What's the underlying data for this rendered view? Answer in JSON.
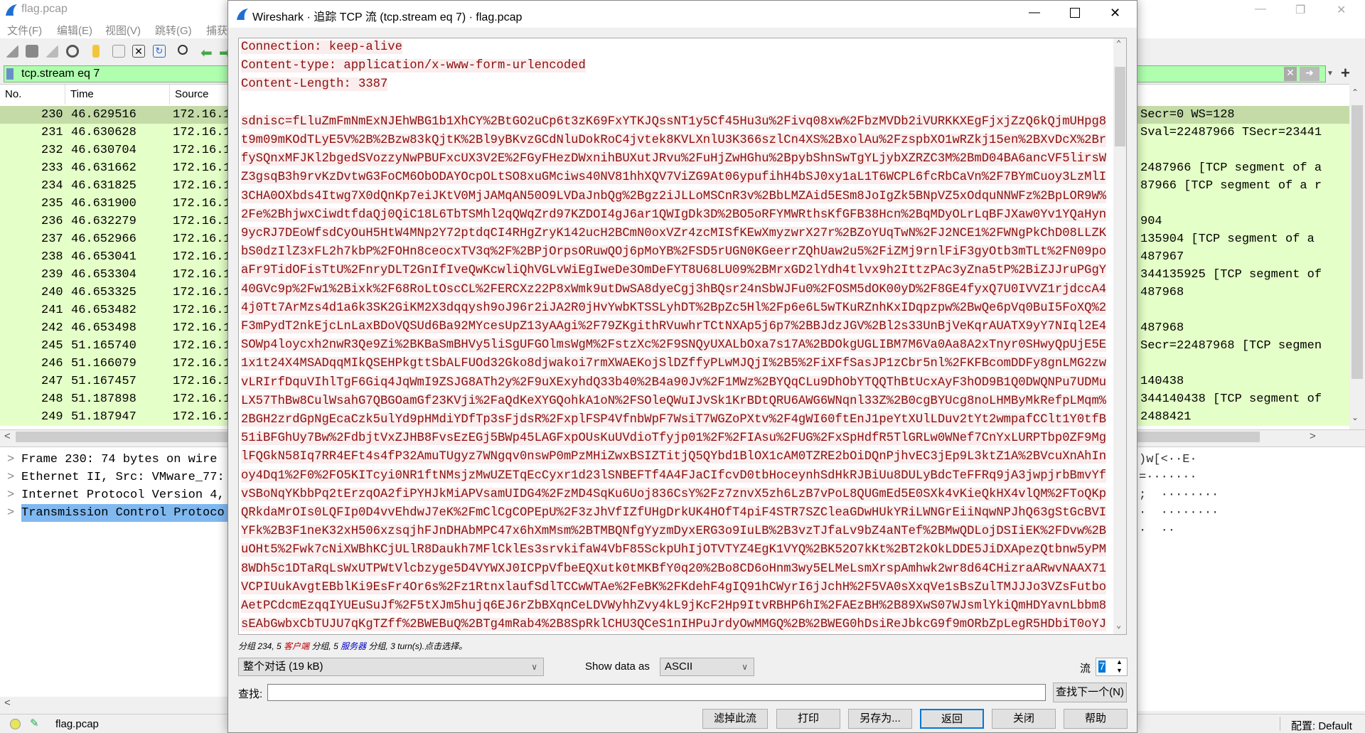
{
  "main_window": {
    "title": "flag.pcap",
    "menu": [
      "文件(F)",
      "编辑(E)",
      "视图(V)",
      "跳转(G)",
      "捕获"
    ],
    "filter_value": "tcp.stream eq 7",
    "columns": [
      "No.",
      "Time",
      "Source"
    ],
    "packets": [
      {
        "no": "230",
        "time": "46.629516",
        "src": "172.16.1",
        "info": "Secr=0 WS=128"
      },
      {
        "no": "231",
        "time": "46.630628",
        "src": "172.16.1",
        "info": "Sval=22487966 TSecr=23441"
      },
      {
        "no": "232",
        "time": "46.630704",
        "src": "172.16.1",
        "info": ""
      },
      {
        "no": "233",
        "time": "46.631662",
        "src": "172.16.1",
        "info": "2487966 [TCP segment of a"
      },
      {
        "no": "234",
        "time": "46.631825",
        "src": "172.16.1",
        "info": "87966 [TCP segment of a r"
      },
      {
        "no": "235",
        "time": "46.631900",
        "src": "172.16.1",
        "info": ""
      },
      {
        "no": "236",
        "time": "46.632279",
        "src": "172.16.1",
        "info": "904"
      },
      {
        "no": "237",
        "time": "46.652966",
        "src": "172.16.1",
        "info": "135904 [TCP segment of a"
      },
      {
        "no": "238",
        "time": "46.653041",
        "src": "172.16.1",
        "info": "487967"
      },
      {
        "no": "239",
        "time": "46.653304",
        "src": "172.16.1",
        "info": "344135925 [TCP segment of"
      },
      {
        "no": "240",
        "time": "46.653325",
        "src": "172.16.1",
        "info": "487968"
      },
      {
        "no": "241",
        "time": "46.653482",
        "src": "172.16.1",
        "info": ""
      },
      {
        "no": "242",
        "time": "46.653498",
        "src": "172.16.1",
        "info": "487968"
      },
      {
        "no": "245",
        "time": "51.165740",
        "src": "172.16.1",
        "info": "Secr=22487968 [TCP segmen"
      },
      {
        "no": "246",
        "time": "51.166079",
        "src": "172.16.1",
        "info": ""
      },
      {
        "no": "247",
        "time": "51.167457",
        "src": "172.16.1",
        "info": "140438"
      },
      {
        "no": "248",
        "time": "51.187898",
        "src": "172.16.1",
        "info": "344140438 [TCP segment of"
      },
      {
        "no": "249",
        "time": "51.187947",
        "src": "172.16.1",
        "info": "2488421"
      }
    ],
    "selected_packet": "230",
    "details": [
      "Frame 230: 74 bytes on wire",
      "Ethernet II, Src: VMware_77:",
      "Internet Protocol Version 4,",
      "Transmission Control Protoco"
    ],
    "bytes_ascii": [
      ")w[<··E·",
      "=·······",
      ";  ········",
      "·  ········",
      "·  ··"
    ],
    "status_file": "flag.pcap",
    "status_profile": "配置: Default"
  },
  "dialog": {
    "title": "Wireshark · 追踪 TCP 流 (tcp.stream eq 7) · flag.pcap",
    "headers": [
      "Connection: keep-alive",
      "Content-type: application/x-www-form-urlencoded",
      "Content-Length: 3387"
    ],
    "body_lines": [
      "sdnisc=fLluZmFmNmExNJEhWBG1b1XhCY%2BtGO2uCp6t3zK69FxYTKJQssNT1y5Cf45Hu3u%2Fivq08xw%2FbzMVDb2iVURKKXEgFjxjZzQ6kQjmUHpg8",
      "t9m09mKOdTLyE5V%2B%2Bzw83kQjtK%2Bl9yBKvzGCdNluDokRoC4jvtek8KVLXnlU3K366szlCn4XS%2BxolAu%2FzspbXO1wRZkj15en%2BXvDcX%2Br",
      "fySQnxMFJKl2bgedSVozzyNwPBUFxcUX3V2E%2FGyFHezDWxnihBUXutJRvu%2FuHjZwHGhu%2BpybShnSwTgYLjybXZRZC3M%2BmD04BA6ancVF5lirsW",
      "Z3gsqB3h9rvKzDvtwG3FoCM6ObODAYOcpOLtSO8xuGMciws40NV81hhXQV7ViZG9At06ypufihH4bSJ0xy1aL1T6WCPL6fcRbCaVn%2F7BYmCuoy3LzMlI",
      "3CHA0OXbds4Itwg7X0dQnKp7eiJKtV0MjJAMqAN50O9LVDaJnbQg%2Bgz2iJLLoMSCnR3v%2BbLMZAid5ESm8JoIgZk5BNpVZ5xOdquNNWFz%2BpLOR9W%",
      "2Fe%2BhjwxCiwdtfdaQj0QiC18L6TbTSMhl2qQWqZrd97KZDOI4gJ6ar1QWIgDk3D%2BO5oRFYMWRthsKfGFB38Hcn%2BqMDyOLrLqBFJXaw0Yv1YQaHyn",
      "9ycRJ7DEoWfsdCyOuH5HtW4MNp2Y72ptdqCI4RHgZryK142ucH2BCmN0oxVZr4zcMISfKEwXmyzwrX27r%2BZoYUqTwN%2FJ2NCE1%2FWNgPkChD08LLZK",
      "bS0dzIlZ3xFL2h7kbP%2FOHn8ceocxTV3q%2F%2BPjOrpsORuwQOj6pMoYB%2FSD5rUGN0KGeerrZQhUaw2u5%2FiZMj9rnlFiF3gyOtb3mTLt%2FN09po",
      "aFr9TidOFisTtU%2FnryDLT2GnIfIveQwKcwliQhVGLvWiEgIweDe3OmDeFYT8U68LU09%2BMrxGD2lYdh4tlvx9h2IttzPAc3yZna5tP%2BiZJJruPGgY",
      "40GVc9p%2Fw1%2Bixk%2F68RoLtOscCL%2FERCXz22P8xWmk9utDwSA8dyeCgj3hBQsr24nSbWJFu0%2FOSM5dOK00yD%2F8GE4fyxQ7U0IVVZ1rjdccA4",
      "4j0Tt7ArMzs4d1a6k3SK2GiKM2X3dqqysh9oJ96r2iJA2R0jHvYwbKTSSLyhDT%2BpZc5Hl%2Fp6e6L5wTKuRZnhKxIDqpzpw%2BwQe6pVq0BuI5FoXQ%2",
      "F3mPydT2nkEjcLnLaxBDoVQSUd6Ba92MYcesUpZ13yAAgi%2F79ZKgithRVuwhrTCtNXAp5j6p7%2BBJdzJGV%2Bl2s33UnBjVeKqrAUATX9yY7NIql2E4",
      "SOWp4loycxh2nwR3Qe9Zi%2BKBaSmBHVy5liSgUFGOlmsWgM%2FstzXc%2F9SNQyUXALbOxa7s17A%2BDOkgUGLIBM7M6Va0Aa8A2xTnyr0SHwyQpUjE5E",
      "1x1t24X4MSADqqMIkQSEHPkgttSbALFUOd32Gko8djwakoi7rmXWAEKojSlDZffyPLwMJQjI%2B5%2FiXFfSasJP1zCbr5nl%2FKFBcomDDFy8gnLMG2zw",
      "vLRIrfDquVIhlTgF6Giq4JqWmI9ZSJG8ATh2y%2F9uXExyhdQ33b40%2B4a90Jv%2F1MWz%2BYQqCLu9DhObYTQQThBtUcxAyF3hOD9B1Q0DWQNPu7UDMu",
      "LX57ThBw8CulWsahG7QBGOamGf23KVji%2FaQdKeXYGQohkA1oN%2FSOleQWuIJvSk1KrBDtQRU6AWG6WNqnl33Z%2B0cgBYUcg8noLHMByMkRefpLMqm%",
      "2BGH2zrdGpNgEcaCzk5ulYd9pHMdiYDfTp3sFjdsR%2FxplFSP4VfnbWpF7WsiT7WGZoPXtv%2F4gWI60ftEnJ1peYtXUlLDuv2tYt2wmpafCClt1Y0tfB",
      "51iBFGhUy7Bw%2FdbjtVxZJHB8FvsEzEGj5BWp45LAGFxpOUsKuUVdioTfyjp01%2F%2FIAsu%2FUG%2FxSpHdfR5TlGRLw0WNef7CnYxLURPTbp0ZF9Mg",
      "lFQGkN58Iq7RR4EFt4s4fP32AmuTUgyz7WNgqv0nswP0mPzMHiZwxBSIZTitjQ5QYbd1BlOX1cAM0TZRE2bOiDQnPjhvEC3jEp9L3ktZ1A%2BVcuXnAhIn",
      "oy4Dq1%2F0%2FO5KITcyi0NR1ftNMsjzMwUZETqEcCyxr1d23lSNBEFTf4A4FJaCIfcvD0tbHoceynhSdHkRJBiUu8DULyBdcTeFFRq9jA3jwpjrbBmvYf",
      "vSBoNqYKbbPq2tErzqOA2fiPYHJkMiAPVsamUIDG4%2FzMD4SqKu6Uoj836CsY%2Fz7znvX5zh6LzB7vPoL8QUGmEd5E0SXk4vKieQkHX4vlQM%2FToQKp",
      "QRkdaMrOIs0LQFIp0D4vvEhdwJ7eK%2FmClCgCOPEpU%2F3zJhVfIZfUHgDrkUK4HOfT4piF4STR7SZCleaGDwHUkYRiLWNGrEiiNqwNPJhQ63gStGcBVI",
      "YFk%2B3F1neK32xH506xzsqjhFJnDHAbMPC47x6hXmMsm%2BTMBQNfgYyzmDyxERG3o9IuLB%2B3vzTJfaLv9bZ4aNTef%2BMwQDLojDSIiEK%2FDvw%2B",
      "uOHt5%2Fwk7cNiXWBhKCjULlR8Daukh7MFlCklEs3srvkifaW4VbF85SckpUhIjOTVTYZ4EgK1VYQ%2BK52O7kKt%2BT2kOkLDDE5JiDXApezQtbnw5yPM",
      "8WDh5c1DTaRqLsWxUTPWtVlcbzyge5D4VYWXJ0ICPpVfbeEQXutk0tMKBfY0q20%2Bo8CD6oHnm3wy5ELMeLsmXrspAmhwk2wr8d64CHizraARwvNAAX71",
      "VCPIUukAvgtEBblKi9EsFr4Or6s%2Fz1RtnxlaufSdlTCCwWTAe%2FeBK%2FKdehF4gIQ91hCWyrI6jJchH%2F5VA0sXxqVe1sBsZulTMJJJo3VZsFutbo",
      "AetPCdcmEzqqIYUEuSuJf%2F5tXJm5hujq6EJ6rZbBXqnCeLDVWyhhZvy4kL9jKcF2Hp9ItvRBHP6hI%2FAEzBH%2B89XwS07WJsmlYkiQmHDYavnLbbm8",
      "sEAbGwbxCbTUJU7qKgTZff%2BWEBuQ%2BTg4mRab4%2B8SpRklCHU3QCeS1nIHPuJrdyOwMMGQ%2B%2BWEG0hDsiReJbkcG9f9mORbZpLegR5HDbiT0oYJ"
    ],
    "summary": {
      "pre": "分组 234, 5 ",
      "client": "客户端",
      "mid": " 分组, 5 ",
      "server": "服务器",
      "post": " 分组, 3 turn(s).点击选择。"
    },
    "conversation_select": "整个对话 (19 kB)",
    "show_data_label": "Show data as",
    "show_data_value": "ASCII",
    "stream_label": "流",
    "stream_value": "7",
    "find_label": "查找:",
    "find_value": "",
    "find_next": "查找下一个(N)",
    "buttons": [
      "滤掉此流",
      "打印",
      "另存为...",
      "返回",
      "关闭",
      "帮助"
    ],
    "colors": {
      "client_text": "#8b1010",
      "client_bg": "#fbeded",
      "server_link": "#0000c0",
      "client_link": "#c00000",
      "packet_bg": "#e4ffc7",
      "filter_bg": "#afffaf"
    }
  }
}
